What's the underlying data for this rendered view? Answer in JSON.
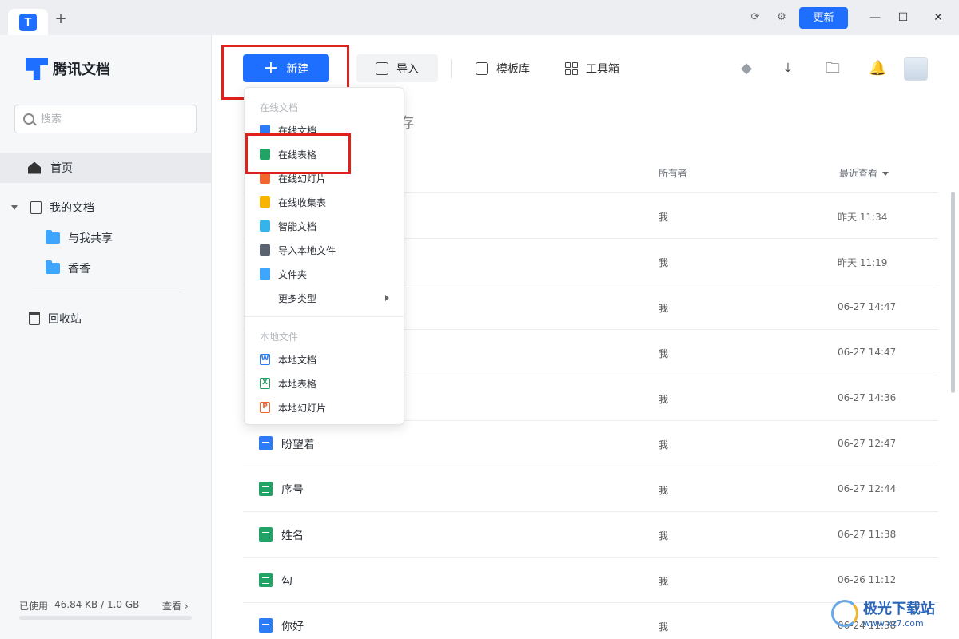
{
  "colors": {
    "accent": "#1e6fff",
    "highlight": "#e0201a",
    "sheet": "#21a366",
    "doc": "#2b7cf6"
  },
  "titlebar": {
    "update_label": "更新"
  },
  "sidebar": {
    "brand": "腾讯文档",
    "search_placeholder": "搜索",
    "home": "首页",
    "my_docs": "我的文档",
    "shared": "与我共享",
    "folder": "香香",
    "trash": "回收站",
    "storage_label": "已使用",
    "storage_value": "46.84 KB / 1.0 GB",
    "storage_view": "查看",
    "storage_used_fraction": 0.0
  },
  "toolbar": {
    "new_label": "新建",
    "import_label": "导入",
    "templates_label": "模板库",
    "tools_label": "工具箱"
  },
  "main": {
    "heading_fragment": "缓存",
    "columns": {
      "owner": "所有者",
      "recent": "最近查看"
    },
    "rows": [
      {
        "name": "",
        "icon": "sheet-icon",
        "owner": "我",
        "time": "昨天 11:34"
      },
      {
        "name": "",
        "icon": "sheet-icon",
        "owner": "我",
        "time": "昨天 11:19"
      },
      {
        "name": "",
        "icon": "sheet-icon",
        "owner": "我",
        "time": "06-27 14:47"
      },
      {
        "name": "",
        "icon": "sheet-icon",
        "owner": "我",
        "time": "06-27 14:47"
      },
      {
        "name": "",
        "icon": "sheet-icon",
        "owner": "我",
        "time": "06-27 14:36"
      },
      {
        "name": "盼望着",
        "icon": "doc-icon",
        "owner": "我",
        "time": "06-27 12:47"
      },
      {
        "name": "序号",
        "icon": "sheet-icon",
        "owner": "我",
        "time": "06-27 12:44"
      },
      {
        "name": "姓名",
        "icon": "sheet-icon",
        "owner": "我",
        "time": "06-27 11:38"
      },
      {
        "name": "勾",
        "icon": "sheet-icon",
        "owner": "我",
        "time": "06-26 11:12"
      },
      {
        "name": "你好",
        "icon": "doc-icon",
        "owner": "我",
        "time": "06-24 11:38"
      }
    ]
  },
  "menu": {
    "online_section": "在线文档",
    "online_items": [
      {
        "label": "在线文档",
        "icon": "online-doc-icon"
      },
      {
        "label": "在线表格",
        "icon": "online-sheet-icon"
      },
      {
        "label": "在线幻灯片",
        "icon": "online-slide-icon"
      },
      {
        "label": "在线收集表",
        "icon": "online-form-icon"
      },
      {
        "label": "智能文档",
        "icon": "smart-doc-icon"
      },
      {
        "label": "导入本地文件",
        "icon": "import-file-icon"
      },
      {
        "label": "文件夹",
        "icon": "folder-icon"
      },
      {
        "label": "更多类型",
        "icon": "more-icon"
      }
    ],
    "local_section": "本地文件",
    "local_items": [
      {
        "label": "本地文档",
        "icon": "word-icon"
      },
      {
        "label": "本地表格",
        "icon": "excel-icon"
      },
      {
        "label": "本地幻灯片",
        "icon": "ppt-icon"
      }
    ]
  },
  "watermark": {
    "name": "极光下载站",
    "url": "www.xz7.com"
  }
}
